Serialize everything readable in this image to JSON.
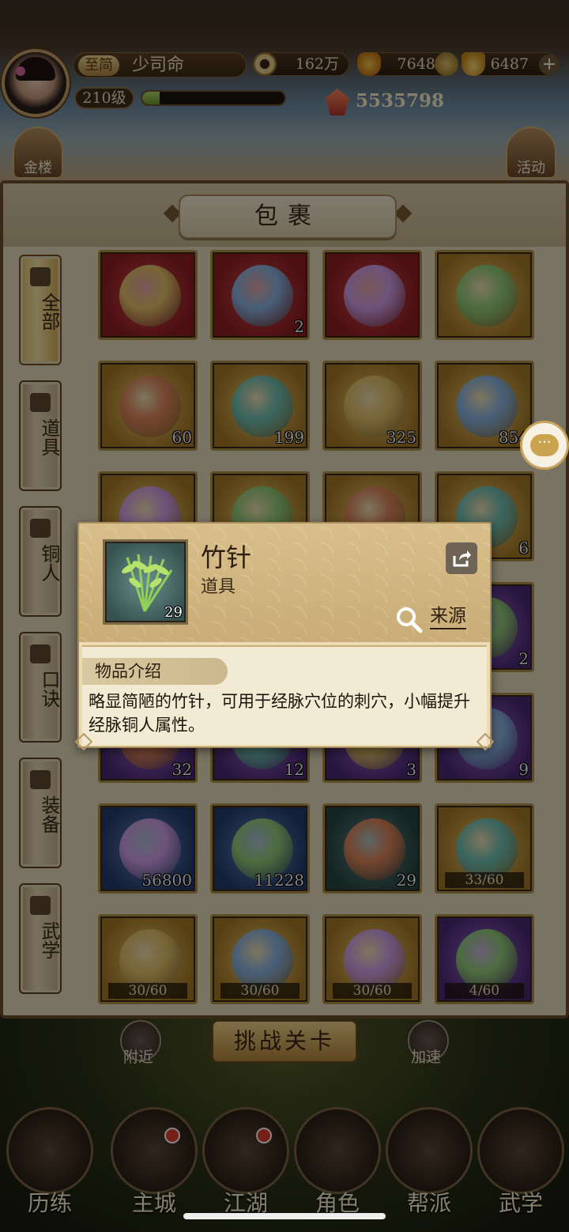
{
  "player": {
    "vip_label": "至简",
    "name": "少司命",
    "level": "210级",
    "exp_fraction": 0.12,
    "power": "5535798"
  },
  "resources": {
    "coins": "162万",
    "yuanbao": "76488",
    "gold": "6487"
  },
  "corner_buttons": {
    "left": "金楼",
    "right": "活动"
  },
  "bag": {
    "title": "包裹",
    "tabs": [
      {
        "label": "全部",
        "active": true
      },
      {
        "label": "道具",
        "active": false
      },
      {
        "label": "铜人",
        "active": false
      },
      {
        "label": "口诀",
        "active": false
      },
      {
        "label": "装备",
        "active": false
      },
      {
        "label": "武学",
        "active": false
      }
    ],
    "rows": [
      [
        {
          "quality": "red",
          "count": ""
        },
        {
          "quality": "red",
          "count": "2"
        },
        {
          "quality": "red",
          "count": ""
        },
        {
          "quality": "gold",
          "count": ""
        }
      ],
      [
        {
          "quality": "gold",
          "count": "60"
        },
        {
          "quality": "gold",
          "count": "199"
        },
        {
          "quality": "gold",
          "count": "325"
        },
        {
          "quality": "gold",
          "count": "854"
        }
      ],
      [
        {
          "quality": "gold",
          "count": ""
        },
        {
          "quality": "gold",
          "count": ""
        },
        {
          "quality": "gold",
          "count": ""
        },
        {
          "quality": "gold",
          "count": "6"
        }
      ],
      [
        {
          "quality": "purple",
          "count": ""
        },
        {
          "quality": "purple",
          "count": ""
        },
        {
          "quality": "purple",
          "count": ""
        },
        {
          "quality": "purple",
          "count": "2"
        }
      ],
      [
        {
          "quality": "purple",
          "count": "32"
        },
        {
          "quality": "purple",
          "count": "12"
        },
        {
          "quality": "purple",
          "count": "3"
        },
        {
          "quality": "purple",
          "count": "9"
        }
      ],
      [
        {
          "quality": "blue",
          "count": "56800"
        },
        {
          "quality": "blue",
          "count": "11228"
        },
        {
          "quality": "green",
          "count": "29"
        },
        {
          "quality": "gold",
          "count": "",
          "fragment": "33/60"
        }
      ],
      [
        {
          "quality": "gold",
          "count": "",
          "fragment": "30/60"
        },
        {
          "quality": "gold",
          "count": "",
          "fragment": "30/60"
        },
        {
          "quality": "gold",
          "count": "",
          "fragment": "30/60"
        },
        {
          "quality": "purple",
          "count": "",
          "fragment": "4/60"
        }
      ]
    ]
  },
  "tooltip": {
    "name": "竹针",
    "type": "道具",
    "count": "29",
    "source_label": "来源",
    "intro_label": "物品介绍",
    "description": "略显简陋的竹针，可用于经脉穴位的刺穴，小幅提升经脉铜人属性。"
  },
  "actions": {
    "challenge": "挑战关卡",
    "nearby": "附近",
    "speedup": "加速"
  },
  "nav": [
    {
      "label": "历练",
      "dot": false
    },
    {
      "label": "主城",
      "dot": true
    },
    {
      "label": "江湖",
      "dot": true
    },
    {
      "label": "角色",
      "dot": false
    },
    {
      "label": "帮派",
      "dot": false
    },
    {
      "label": "武学",
      "dot": false
    }
  ],
  "colors": {
    "accent_gold": "#c9a25e",
    "panel_bg": "#e8dcc0",
    "red_dot": "#e33b2e"
  }
}
